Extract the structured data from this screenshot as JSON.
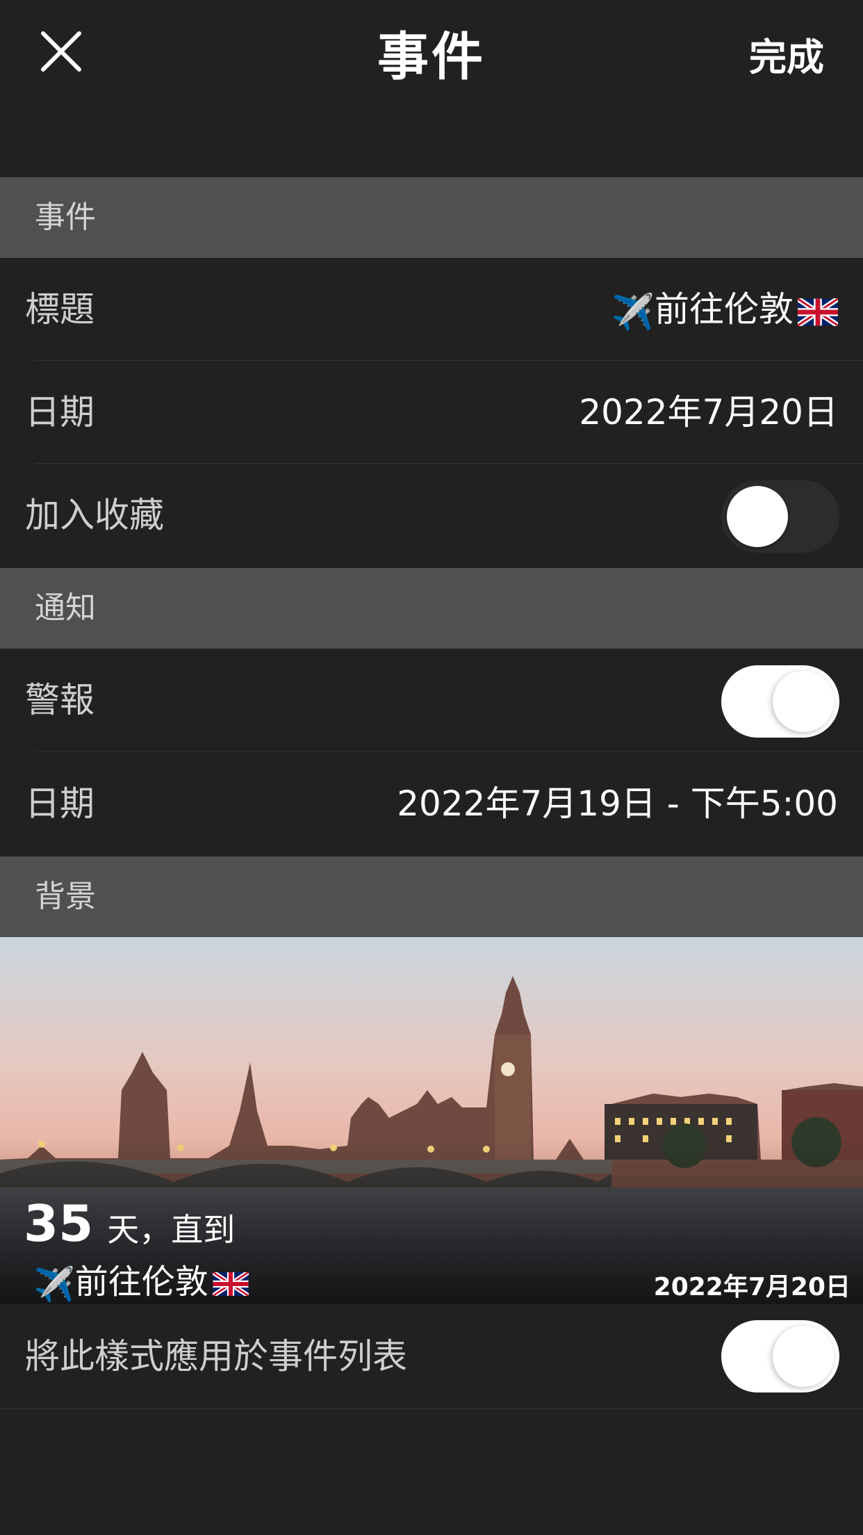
{
  "navbar": {
    "title": "事件",
    "done_label": "完成"
  },
  "sections": {
    "event": "事件",
    "notification": "通知",
    "background": "背景"
  },
  "event": {
    "title_label": "標題",
    "title_prefix_emoji": "✈️",
    "title_value": "前往伦敦",
    "date_label": "日期",
    "date_value": "2022年7月20日",
    "favorite_label": "加入收藏",
    "favorite_on": false
  },
  "notification": {
    "alert_label": "警報",
    "alert_on": true,
    "date_label": "日期",
    "date_value": "2022年7月19日 - 下午5:00"
  },
  "preview": {
    "days_number": "35",
    "days_text": "天，直到",
    "event_emoji": "✈️",
    "event_title": "前往伦敦",
    "event_date": "2022年7月20日"
  },
  "apply": {
    "label": "將此樣式應用於事件列表",
    "on": true
  },
  "colors": {
    "background": "#212121",
    "section_header": "#505050",
    "toggle_on": "#ffffff",
    "toggle_off": "#2c2c2c"
  }
}
